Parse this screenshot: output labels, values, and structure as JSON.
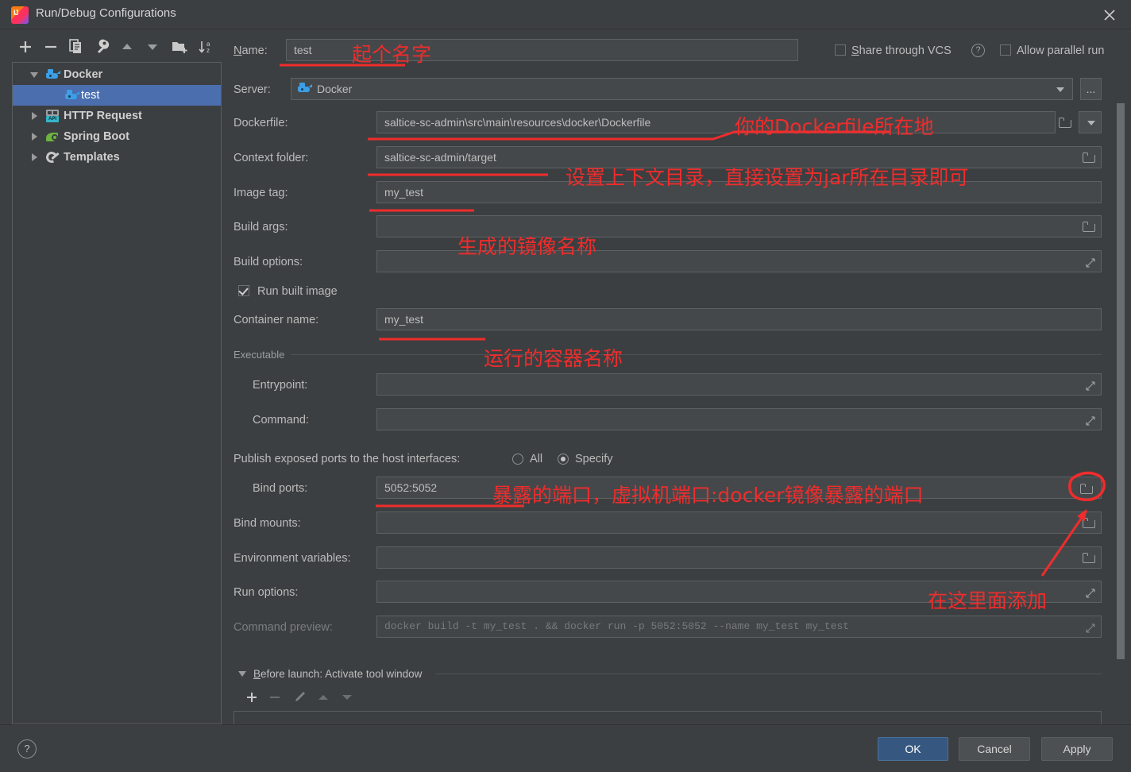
{
  "window": {
    "title": "Run/Debug Configurations",
    "close_icon": "close-icon",
    "app_icon": "intellij-idea-logo"
  },
  "toolbar": {
    "buttons": [
      {
        "name": "add-configuration",
        "icon": "plus-icon"
      },
      {
        "name": "remove-configuration",
        "icon": "minus-icon"
      },
      {
        "name": "copy-configuration",
        "icon": "copy-icon"
      },
      {
        "name": "edit-templates",
        "icon": "wrench-icon"
      },
      {
        "name": "move-up",
        "icon": "chevron-up-icon"
      },
      {
        "name": "move-down",
        "icon": "chevron-down-icon"
      },
      {
        "name": "create-folder",
        "icon": "folder-add-icon"
      },
      {
        "name": "sort-alphabetically",
        "icon": "sort-az-icon"
      }
    ]
  },
  "tree": {
    "items": [
      {
        "label": "Docker",
        "icon": "docker-whale-icon",
        "indent": 0,
        "twisty": "open",
        "selected": false,
        "bold": true
      },
      {
        "label": "test",
        "icon": "docker-whale-icon",
        "indent": 1,
        "twisty": "none",
        "selected": true,
        "bold": false
      },
      {
        "label": "HTTP Request",
        "icon": "http-request-icon",
        "indent": 0,
        "twisty": "closed",
        "selected": false,
        "bold": true
      },
      {
        "label": "Spring Boot",
        "icon": "spring-boot-icon",
        "indent": 0,
        "twisty": "closed",
        "selected": false,
        "bold": true
      },
      {
        "label": "Templates",
        "icon": "wrench-icon",
        "indent": 0,
        "twisty": "closed",
        "selected": false,
        "bold": true
      }
    ]
  },
  "form": {
    "name_label": "Name:",
    "name_value": "test",
    "share_vcs_label": "Share through VCS",
    "share_vcs_checked": false,
    "share_vcs_help_icon": "question-mark-icon",
    "allow_parallel_label": "Allow parallel run",
    "allow_parallel_checked": false,
    "server_label": "Server:",
    "server_value": "Docker",
    "server_browse_label": "...",
    "dockerfile_label": "Dockerfile:",
    "dockerfile_value": "saltice-sc-admin\\src\\main\\resources\\docker\\Dockerfile",
    "context_label": "Context folder:",
    "context_value": "saltice-sc-admin/target",
    "imagetag_label": "Image tag:",
    "imagetag_value": "my_test",
    "buildargs_label": "Build args:",
    "buildargs_value": "",
    "buildoptions_label": "Build options:",
    "buildoptions_value": "",
    "runbuilt_label": "Run built image",
    "runbuilt_checked": true,
    "container_label": "Container name:",
    "container_value": "my_test",
    "executable_group": "Executable",
    "entrypoint_label": "Entrypoint:",
    "entrypoint_value": "",
    "command_label": "Command:",
    "command_value": "",
    "publish_label": "Publish exposed ports to the host interfaces:",
    "publish_all_label": "All",
    "publish_specify_label": "Specify",
    "publish_selected": "Specify",
    "bindports_label": "Bind ports:",
    "bindports_value": "5052:5052",
    "bindmounts_label": "Bind mounts:",
    "bindmounts_value": "",
    "envvars_label": "Environment variables:",
    "envvars_value": "",
    "runoptions_label": "Run options:",
    "runoptions_value": "",
    "cmdpreview_label": "Command preview:",
    "cmdpreview_value": "docker build -t my_test . && docker run -p 5052:5052 --name my_test my_test",
    "before_launch_label": "Before launch: Activate tool window",
    "before_launch_buttons": [
      {
        "name": "before-launch-add",
        "icon": "plus-icon",
        "enabled": true
      },
      {
        "name": "before-launch-remove",
        "icon": "minus-icon",
        "enabled": false
      },
      {
        "name": "before-launch-edit",
        "icon": "pencil-icon",
        "enabled": false
      },
      {
        "name": "before-launch-up",
        "icon": "chevron-up-icon",
        "enabled": false
      },
      {
        "name": "before-launch-down",
        "icon": "chevron-down-icon",
        "enabled": false
      }
    ]
  },
  "buttons": {
    "help": "?",
    "ok": "OK",
    "cancel": "Cancel",
    "apply": "Apply"
  },
  "annotations": {
    "color": "#f02c2c",
    "name_note": "起个名字",
    "dockerfile_note": "你的Dockerfile所在地",
    "context_note": "设置上下文目录，直接设置为jar所在目录即可",
    "imagetag_note": "生成的镜像名称",
    "container_note": "运行的容器名称",
    "bindports_note": "暴露的端口，虚拟机端口:docker镜像暴露的端口",
    "add_here_note": "在这里面添加"
  }
}
